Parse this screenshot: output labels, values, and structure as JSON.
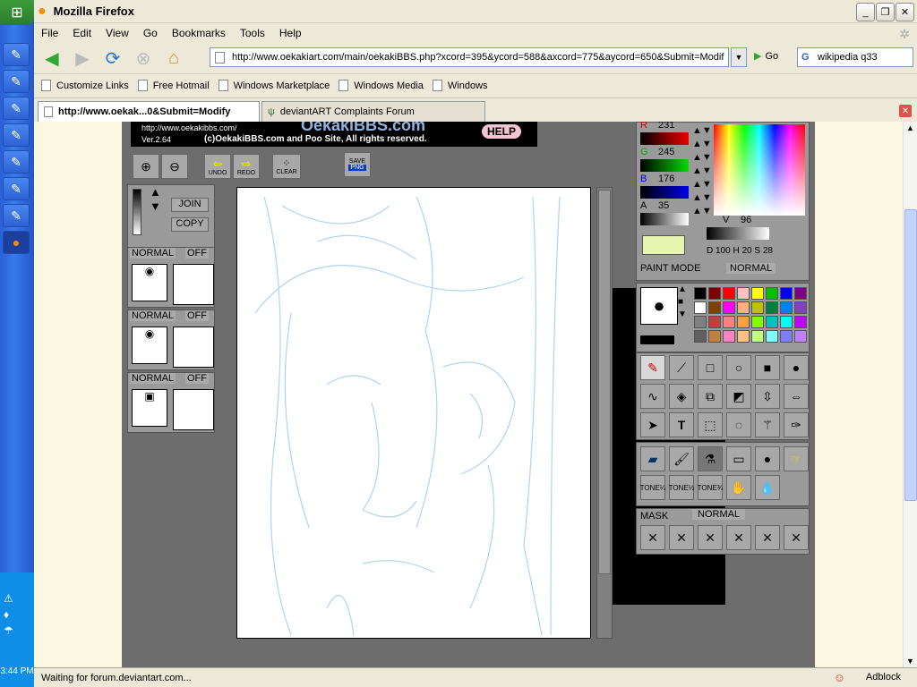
{
  "window": {
    "title": "Mozilla Firefox"
  },
  "menu": [
    "File",
    "Edit",
    "View",
    "Go",
    "Bookmarks",
    "Tools",
    "Help"
  ],
  "nav": {
    "url": "http://www.oekakiart.com/main/oekakiBBS.php?xcord=395&ycord=588&axcord=775&aycord=650&Submit=Modif",
    "go_label": "Go",
    "search_value": "wikipedia q33"
  },
  "bookmarks": [
    "Customize Links",
    "Free Hotmail",
    "Windows Marketplace",
    "Windows Media",
    "Windows"
  ],
  "tabs": [
    {
      "label": "http://www.oekak...0&Submit=Modify",
      "active": true
    },
    {
      "label": "deviantART Complaints Forum",
      "active": false
    }
  ],
  "oekaki": {
    "banner_url": "http://www.oekakibbs.com/",
    "banner_logo": "OekakiBBS.com",
    "version": "Ver.2.64",
    "copyright": "(c)OekakiBBS.com and Poo Site, All rights reserved.",
    "help": "HELP",
    "toolbar": {
      "undo": "UNDO",
      "redo": "REDO",
      "clear": "CLEAR",
      "save": "SAVE",
      "png": "PNG"
    },
    "layer_buttons": {
      "join": "JOIN",
      "copy": "COPY"
    },
    "layers": [
      {
        "mode": "NORMAL",
        "off": "OFF"
      },
      {
        "mode": "NORMAL",
        "off": "OFF"
      },
      {
        "mode": "NORMAL",
        "off": "OFF"
      }
    ],
    "color": {
      "r_label": "R",
      "r": "231",
      "g_label": "G",
      "g": "245",
      "b_label": "B",
      "b": "176",
      "a_label": "A",
      "a": "35",
      "v_label": "V",
      "v": "96",
      "dhs": "D 100 H 20  S 28",
      "current_color": "#e7f5b0"
    },
    "paint_mode_label": "PAINT MODE",
    "paint_mode": "NORMAL",
    "palette": [
      "#000000",
      "#800000",
      "#ff0000",
      "#ffc0c0",
      "#ffff00",
      "#00c000",
      "#0000ff",
      "#800080",
      "#ffffff",
      "#804000",
      "#ff00ff",
      "#ffb080",
      "#c0c000",
      "#008040",
      "#0080ff",
      "#8040c0",
      "#808080",
      "#c04040",
      "#ff8080",
      "#ffa040",
      "#80ff00",
      "#00c0c0",
      "#00ffff",
      "#c000ff",
      "#606060",
      "#c08040",
      "#ff80c0",
      "#ffc080",
      "#c0ff80",
      "#80ffff",
      "#8080ff",
      "#c080ff"
    ],
    "tones": [
      "TONE¼",
      "TONE½",
      "TONE¾"
    ],
    "mask_label": "MASK",
    "mask_mode": "NORMAL"
  },
  "status": {
    "text": "Waiting for forum.deviantart.com...",
    "adblock": "Adblock"
  },
  "clock": "3:44 PM"
}
